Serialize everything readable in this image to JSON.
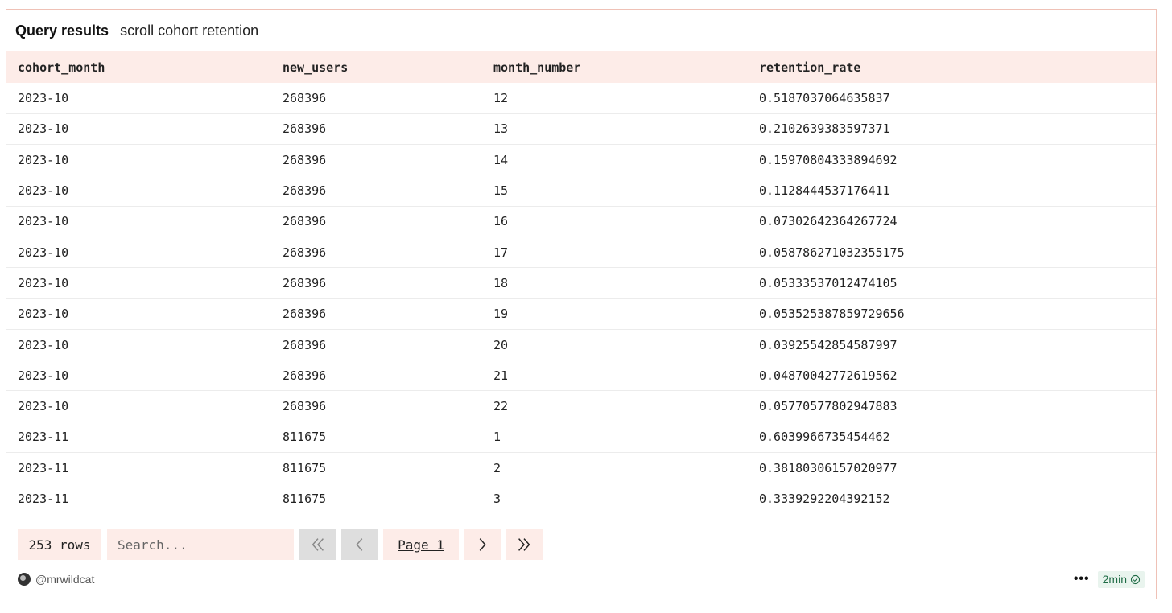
{
  "header": {
    "title": "Query results",
    "subtitle": "scroll cohort retention"
  },
  "table": {
    "columns": [
      "cohort_month",
      "new_users",
      "month_number",
      "retention_rate"
    ],
    "rows": [
      [
        "2023-10",
        "268396",
        "12",
        "0.5187037064635837"
      ],
      [
        "2023-10",
        "268396",
        "13",
        "0.2102639383597371"
      ],
      [
        "2023-10",
        "268396",
        "14",
        "0.15970804333894692"
      ],
      [
        "2023-10",
        "268396",
        "15",
        "0.1128444537176411"
      ],
      [
        "2023-10",
        "268396",
        "16",
        "0.07302642364267724"
      ],
      [
        "2023-10",
        "268396",
        "17",
        "0.058786271032355175"
      ],
      [
        "2023-10",
        "268396",
        "18",
        "0.05333537012474105"
      ],
      [
        "2023-10",
        "268396",
        "19",
        "0.053525387859729656"
      ],
      [
        "2023-10",
        "268396",
        "20",
        "0.03925542854587997"
      ],
      [
        "2023-10",
        "268396",
        "21",
        "0.04870042772619562"
      ],
      [
        "2023-10",
        "268396",
        "22",
        "0.05770577802947883"
      ],
      [
        "2023-11",
        "811675",
        "1",
        "0.6039966735454462"
      ],
      [
        "2023-11",
        "811675",
        "2",
        "0.38180306157020977"
      ],
      [
        "2023-11",
        "811675",
        "3",
        "0.3339292204392152"
      ]
    ]
  },
  "pager": {
    "row_count": "253 rows",
    "search_placeholder": "Search...",
    "page_label": "Page 1",
    "first_icon": "double-chevron-left-icon",
    "prev_icon": "chevron-left-icon",
    "next_icon": "chevron-right-icon",
    "last_icon": "double-chevron-right-icon"
  },
  "footer": {
    "author": "@mrwildcat",
    "more": "•••",
    "time": "2min",
    "time_icon": "check-circle-icon"
  },
  "colors": {
    "accent_bg": "#fdece8",
    "border": "#efc1b6",
    "disabled_bg": "#dedede",
    "badge_bg": "#e9f4ee",
    "badge_text": "#1e6b45"
  }
}
